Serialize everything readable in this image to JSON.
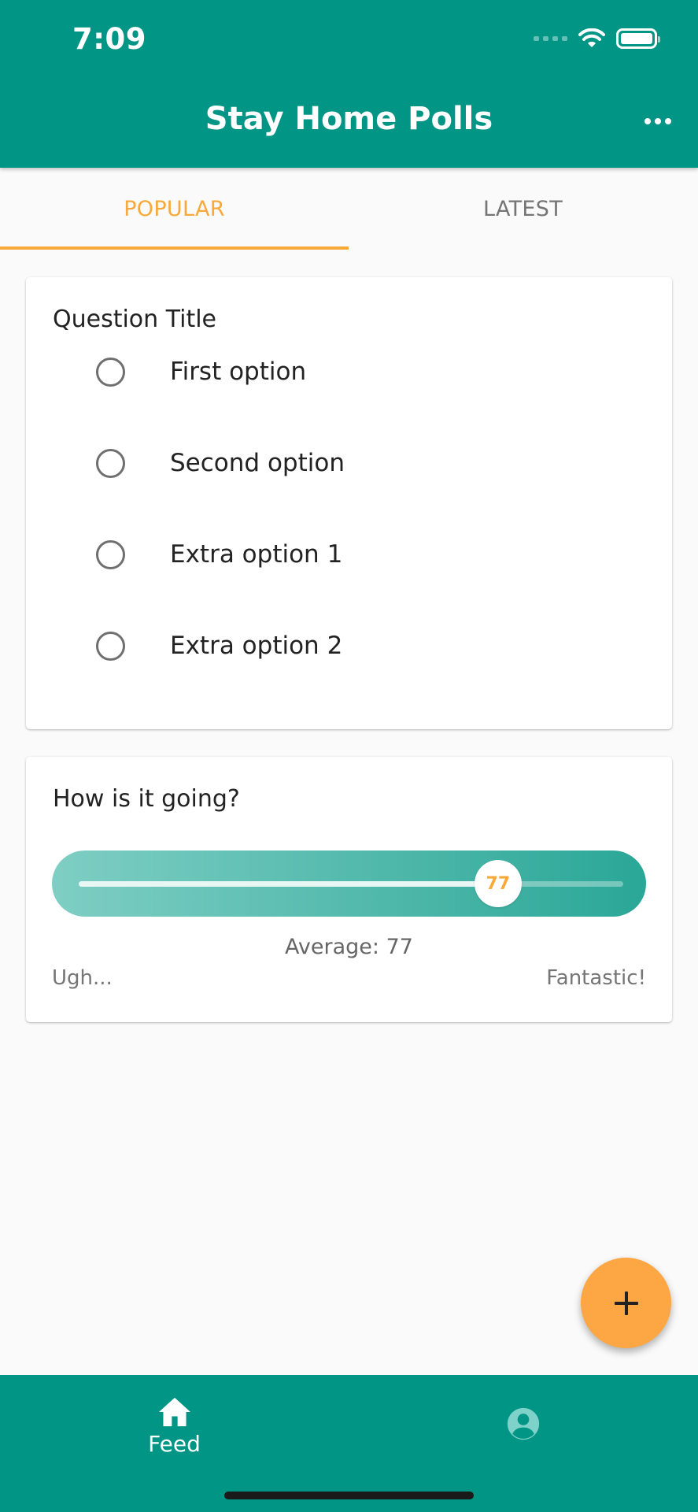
{
  "status_bar": {
    "time": "7:09"
  },
  "app_bar": {
    "title": "Stay Home Polls",
    "more_icon": "more-horizontal-icon"
  },
  "tabs": [
    {
      "label": "POPULAR",
      "selected": true
    },
    {
      "label": "LATEST",
      "selected": false
    }
  ],
  "poll_card": {
    "question": "Question Title",
    "options": [
      "First option",
      "Second option",
      "Extra option 1",
      "Extra option 2"
    ]
  },
  "rating_card": {
    "question": "How is it going?",
    "slider_value": "77",
    "slider_fraction": 0.77,
    "average_text": "Average: 77",
    "min_label": "Ugh...",
    "max_label": "Fantastic!"
  },
  "fab": {
    "icon": "plus-icon"
  },
  "bottom_nav": {
    "items": [
      {
        "label": "Feed",
        "icon": "home-icon",
        "selected": true
      },
      {
        "label": "",
        "icon": "account-icon",
        "selected": false
      }
    ]
  },
  "colors": {
    "primary": "#009585",
    "accent": "#f8a93a",
    "fab": "#fda744"
  }
}
